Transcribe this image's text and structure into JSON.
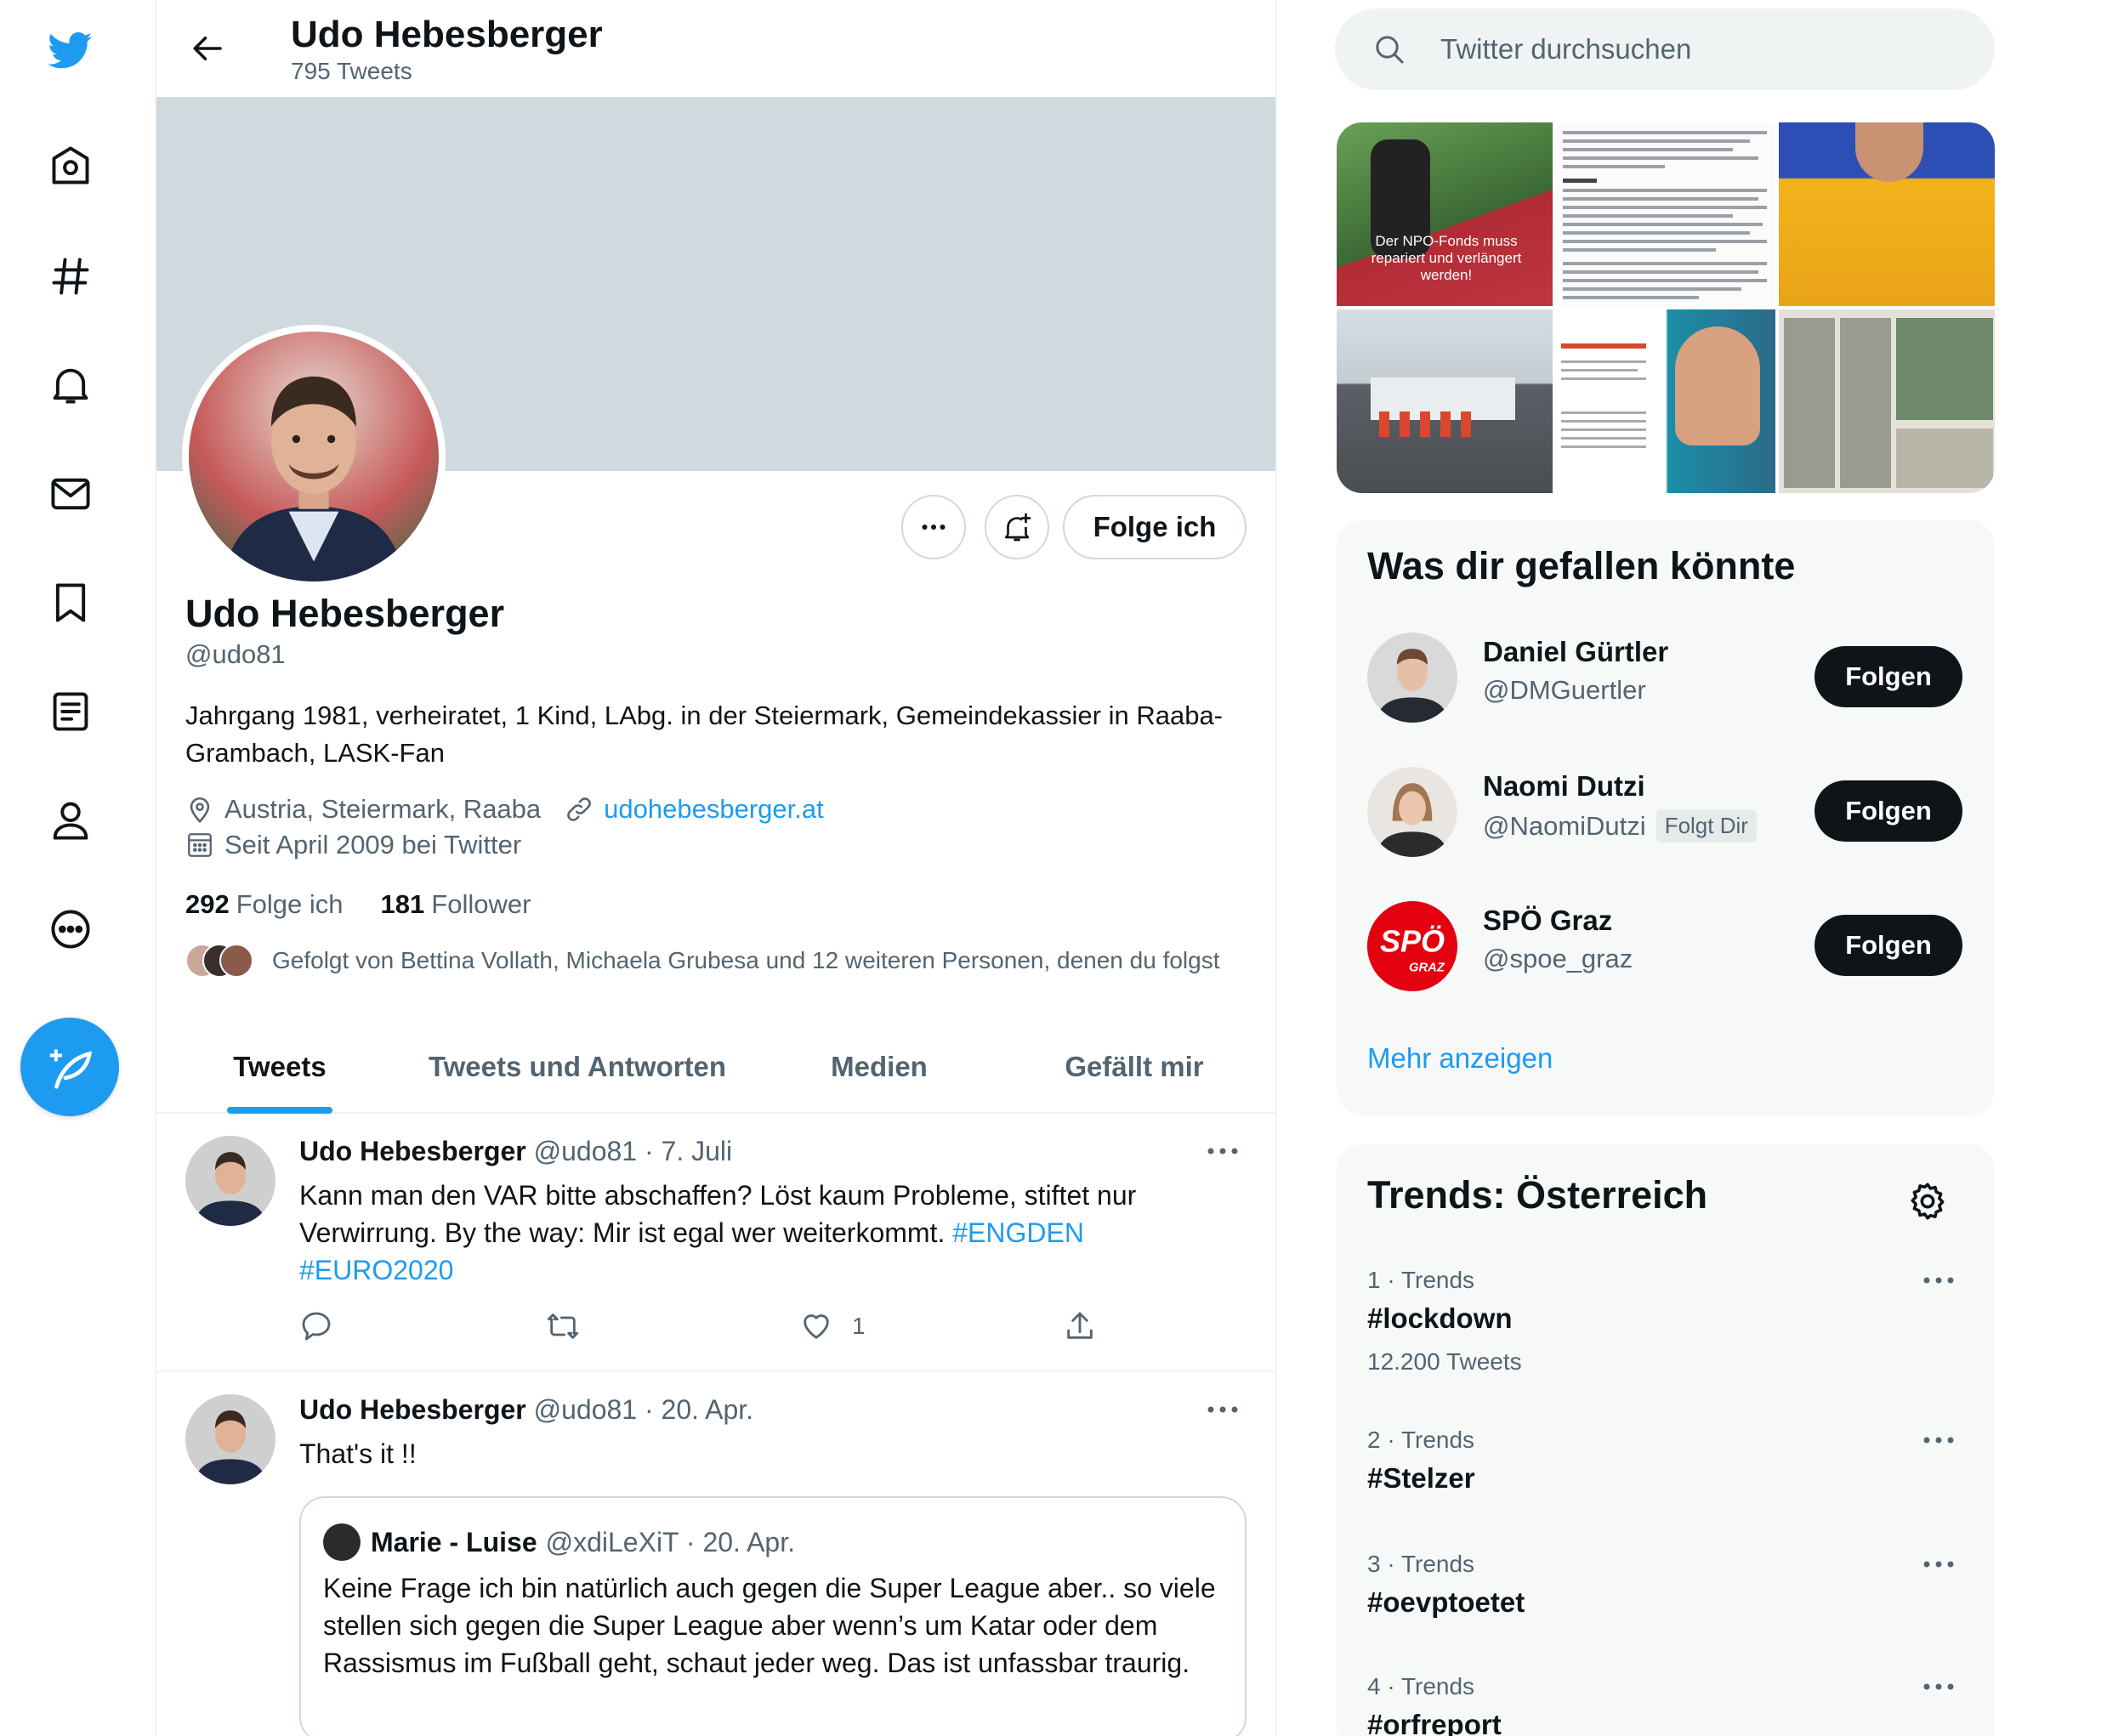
{
  "profile": {
    "header_name": "Udo Hebesberger",
    "tweet_count": "795 Tweets",
    "name": "Udo Hebesberger",
    "handle": "@udo81",
    "bio": "Jahrgang 1981, verheiratet, 1 Kind, LAbg. in der Steiermark, Gemeindekassier in Raaba-Grambach, LASK-Fan",
    "location": "Austria, Steiermark, Raaba",
    "website": "udohebesberger.at",
    "joined": "Seit April 2009 bei Twitter",
    "following_count": "292",
    "following_label": "Folge ich",
    "followers_count": "181",
    "followers_label": "Follower",
    "followed_by": "Gefolgt von Bettina Vollath, Michaela Grubesa und 12 weiteren Personen, denen du folgst",
    "follow_button": "Folge ich"
  },
  "tabs": [
    "Tweets",
    "Tweets und Antworten",
    "Medien",
    "Gefällt mir"
  ],
  "tweets": [
    {
      "name": "Udo Hebesberger",
      "meta": "@udo81 · 7. Juli",
      "text": "Kann man den VAR bitte abschaffen? Löst kaum Probleme, stiftet nur Verwirrung. By the way: Mir ist egal wer weiterkommt. ",
      "hashtag1": "#ENGDEN",
      "hashtag2": "#EURO2020",
      "likes": "1"
    },
    {
      "name": "Udo Hebesberger",
      "meta": "@udo81 · 20. Apr.",
      "text": "That's it !!",
      "quote": {
        "name": "Marie - Luise",
        "meta": "@xdiLeXiT · 20. Apr.",
        "text": "Keine Frage ich bin natürlich auch gegen die Super League aber.. so viele stellen sich  gegen die Super League aber wenn’s um Katar oder dem Rassismus im Fußball geht, schaut jeder weg. Das ist unfassbar traurig."
      }
    }
  ],
  "search": {
    "placeholder": "Twitter durchsuchen"
  },
  "media": {
    "tile1_caption": "Der NPO-Fonds muss repariert und verlängert werden!"
  },
  "who_to_follow": {
    "title": "Was dir gefallen könnte",
    "users": [
      {
        "name": "Daniel Gürtler",
        "handle": "@DMGuertler",
        "button": "Folgen"
      },
      {
        "name": "Naomi Dutzi",
        "handle": "@NaomiDutzi",
        "badge": "Folgt Dir",
        "button": "Folgen"
      },
      {
        "name": "SPÖ Graz",
        "handle": "@spoe_graz",
        "button": "Folgen"
      }
    ],
    "more": "Mehr anzeigen"
  },
  "trends": {
    "title": "Trends: Österreich",
    "items": [
      {
        "meta": "1 · Trends",
        "name": "#lockdown",
        "count": "12.200 Tweets"
      },
      {
        "meta": "2 · Trends",
        "name": "#Stelzer"
      },
      {
        "meta": "3 · Trends",
        "name": "#oevptoetet"
      },
      {
        "meta": "4 · Trends",
        "name": "#orfreport"
      }
    ]
  },
  "colors": {
    "accent": "#1d9bf0",
    "text": "#0f1419",
    "muted": "#536471",
    "banner": "#cfd9de"
  },
  "icons": [
    "twitter-logo-icon",
    "home-icon",
    "explore-icon",
    "notifications-icon",
    "messages-icon",
    "bookmarks-icon",
    "lists-icon",
    "profile-icon",
    "more-icon",
    "compose-icon",
    "back-arrow-icon",
    "search-icon",
    "location-icon",
    "link-icon",
    "calendar-icon",
    "reply-icon",
    "retweet-icon",
    "like-icon",
    "share-icon",
    "settings-icon"
  ]
}
